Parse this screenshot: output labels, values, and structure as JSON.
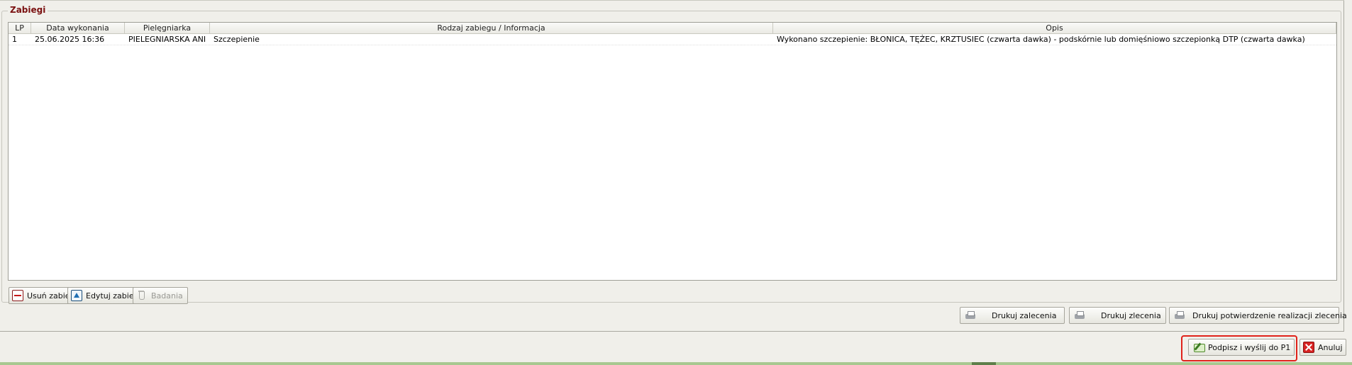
{
  "group": {
    "title": "Zabiegi"
  },
  "table": {
    "columns": [
      "LP",
      "Data wykonania",
      "Pielęgniarka",
      "Rodzaj zabiegu / Informacja",
      "Opis"
    ],
    "rows": [
      {
        "lp": "1",
        "date": "25.06.2025 16:36",
        "nurse": "PIELEGNIARSKA ANI",
        "type": "Szczepienie",
        "desc": "Wykonano szczepienie: BŁONICA, TĘŻEC, KRZTUSIEC (czwarta dawka) - podskórnie lub domięśniowo szczepionką DTP (czwarta dawka)"
      }
    ]
  },
  "actions": {
    "remove": "Usuń zabieg",
    "edit": "Edytuj zabieg",
    "tests": "Badania"
  },
  "print": {
    "recommendations": "Drukuj zalecenia",
    "orders": "Drukuj zlecenia",
    "confirmation": "Drukuj potwierdzenie realizacji zlecenia"
  },
  "footer": {
    "sign_send": "Podpisz i wyślij do P1",
    "cancel": "Anuluj"
  },
  "icons": {
    "remove": "minus-icon",
    "edit": "arrow-up-icon",
    "tests": "flask-icon",
    "print": "printer-icon",
    "sign": "sign-icon",
    "cancel": "close-icon"
  },
  "colors": {
    "legend": "#7a1010",
    "highlight": "#e0221a",
    "background": "#f0efea"
  }
}
